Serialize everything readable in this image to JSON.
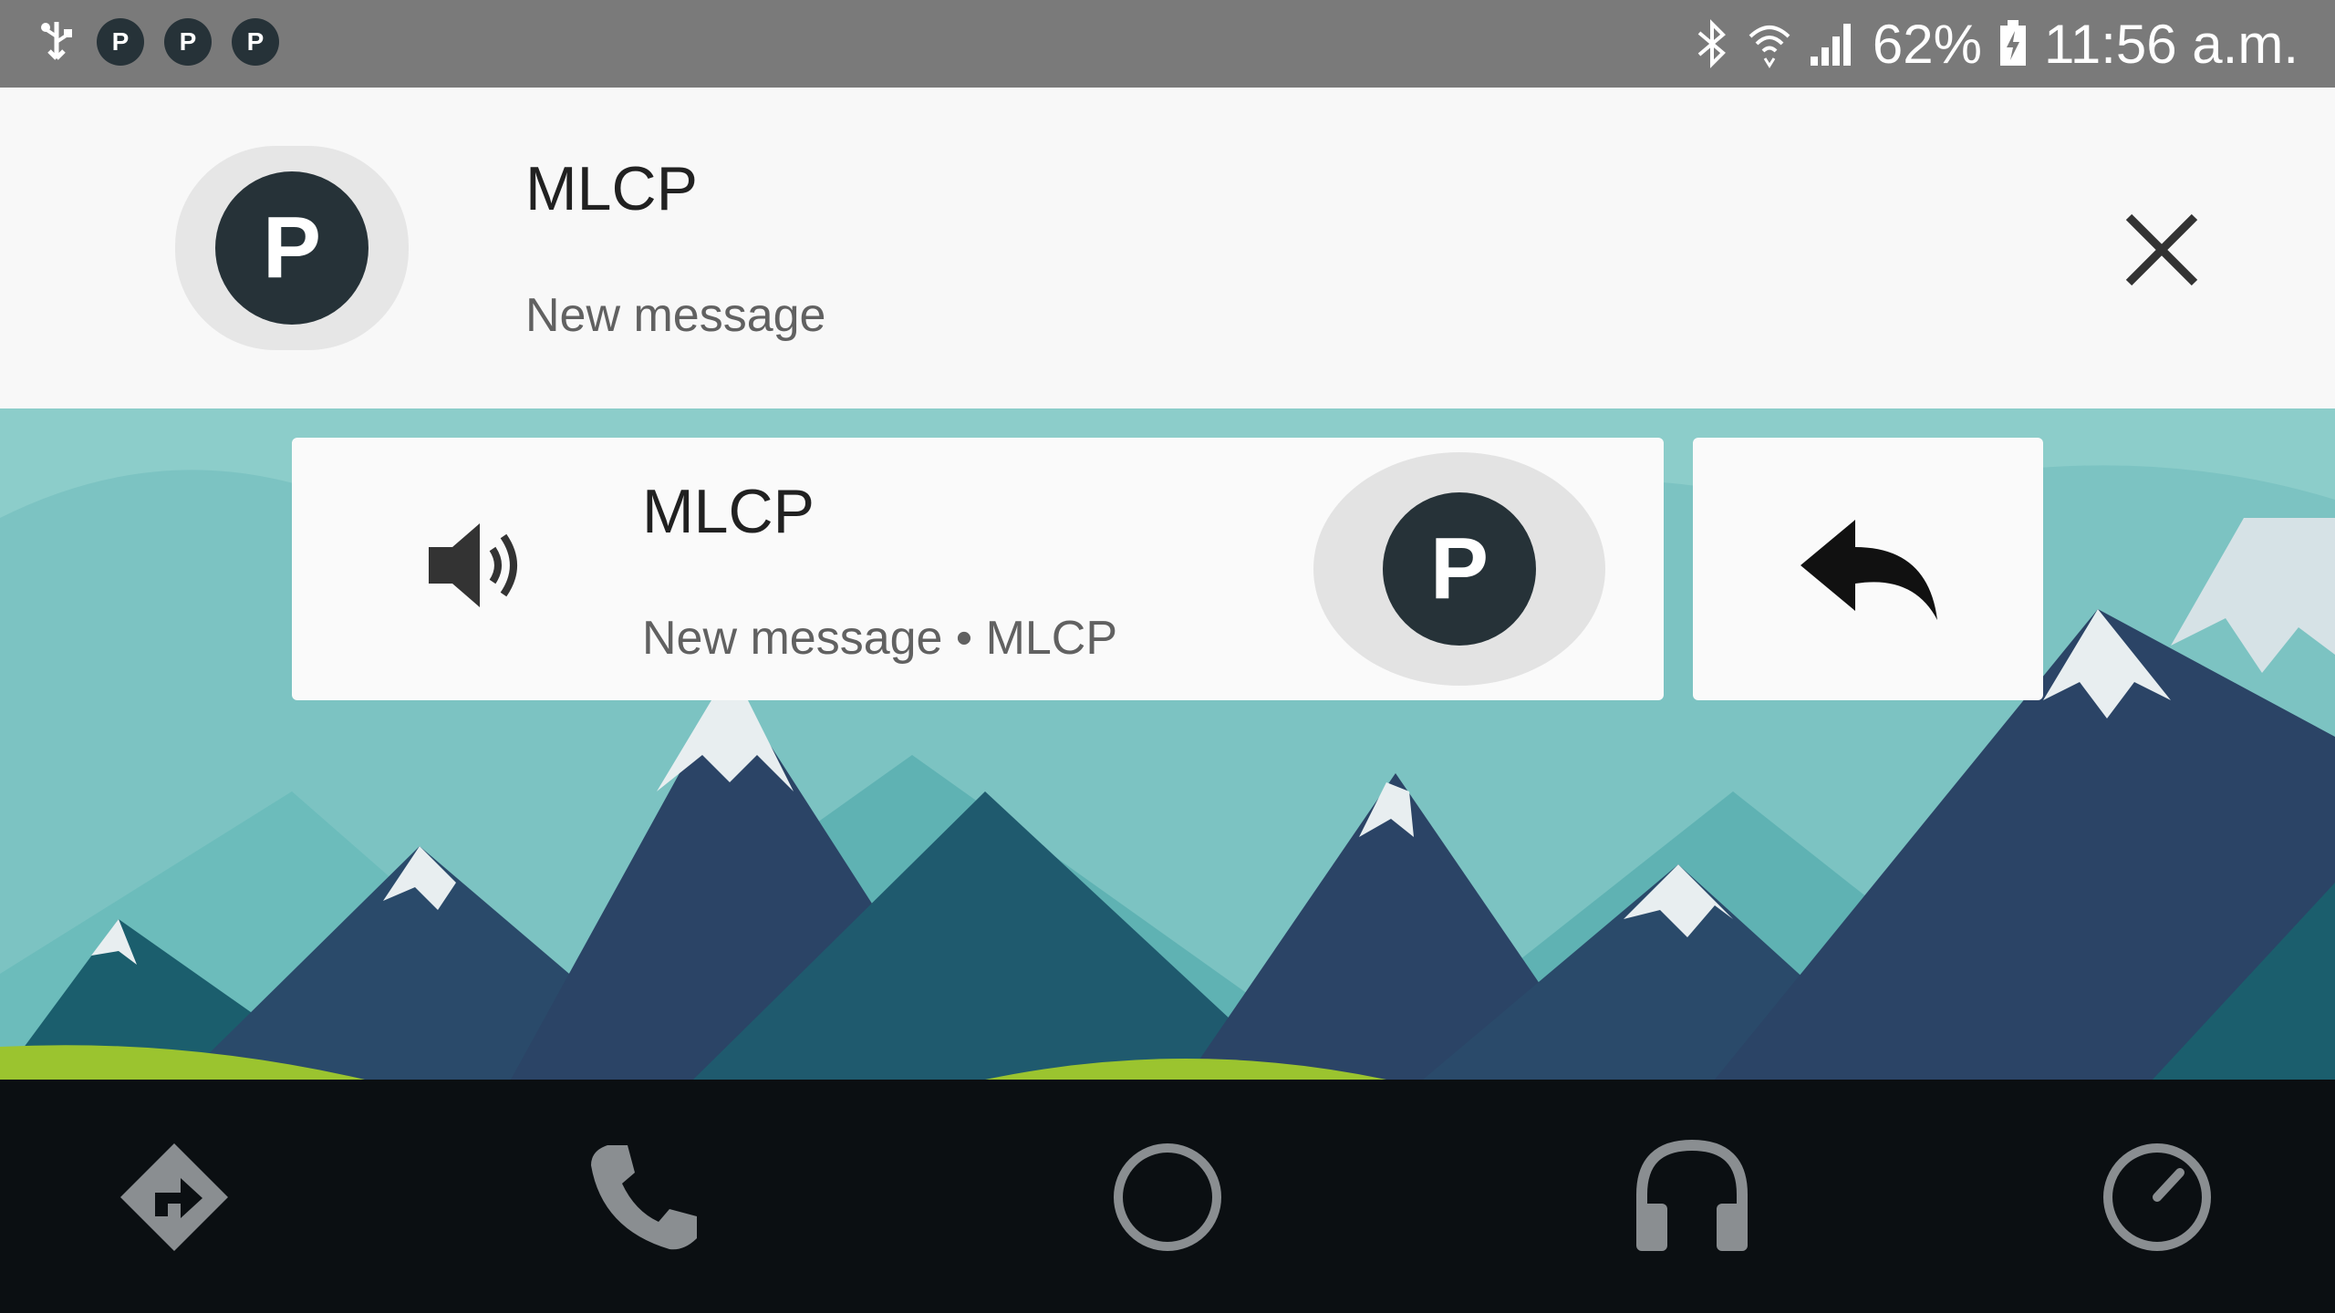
{
  "status_bar": {
    "notification_icons": [
      "usb-icon",
      "P",
      "P",
      "P"
    ],
    "battery": "62%",
    "time": "11:56 a.m.",
    "icons": [
      "bluetooth-icon",
      "wifi-icon",
      "signal-icon",
      "battery-charging-icon"
    ]
  },
  "heads_up": {
    "avatar_letter": "P",
    "title": "MLCP",
    "subtitle": "New message"
  },
  "message_card": {
    "title": "MLCP",
    "subtitle": "New message • MLCP",
    "avatar_letter": "P"
  },
  "nav": {
    "items": [
      "navigation-icon",
      "phone-icon",
      "home-icon",
      "headphones-icon",
      "exit-icon"
    ]
  },
  "colors": {
    "status_bar": "#7a7a7a",
    "avatar": "#263238",
    "nav_bar": "#0b0f12",
    "nav_icon": "#8a8e91"
  }
}
